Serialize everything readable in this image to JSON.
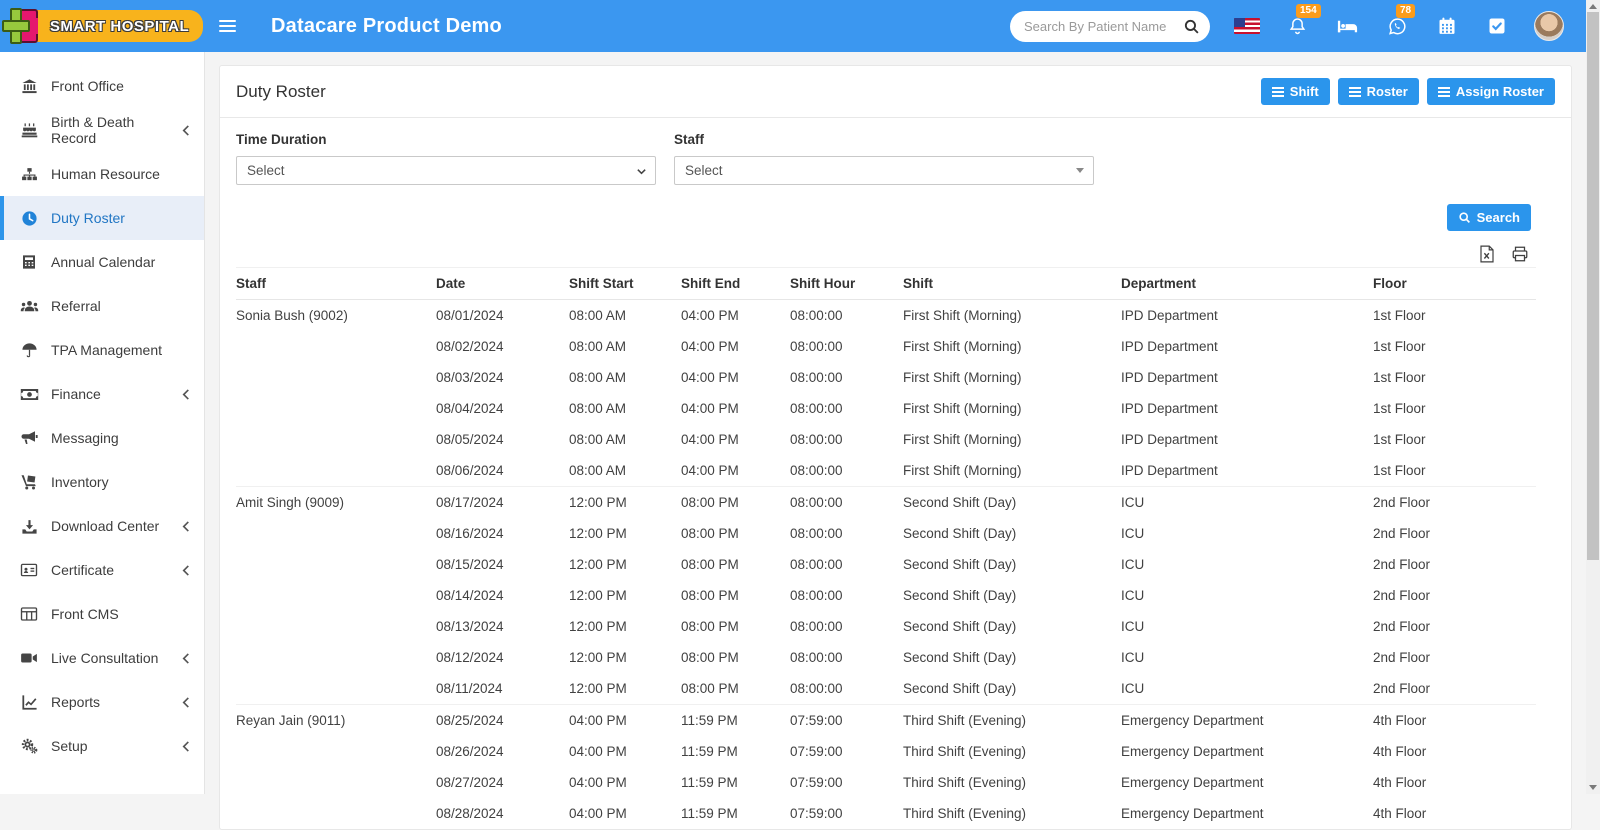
{
  "navbar": {
    "brand": "SMART HOSPITAL",
    "title": "Datacare Product Demo",
    "search_placeholder": "Search By Patient Name",
    "notification_badge": "154",
    "whatsapp_badge": "78"
  },
  "sidebar": {
    "items": [
      {
        "label": "Front Office"
      },
      {
        "label": "Birth & Death Record",
        "expandable": true
      },
      {
        "label": "Human Resource"
      },
      {
        "label": "Duty Roster",
        "active": true
      },
      {
        "label": "Annual Calendar"
      },
      {
        "label": "Referral"
      },
      {
        "label": "TPA Management"
      },
      {
        "label": "Finance",
        "expandable": true
      },
      {
        "label": "Messaging"
      },
      {
        "label": "Inventory"
      },
      {
        "label": "Download Center",
        "expandable": true
      },
      {
        "label": "Certificate",
        "expandable": true
      },
      {
        "label": "Front CMS"
      },
      {
        "label": "Live Consultation",
        "expandable": true
      },
      {
        "label": "Reports",
        "expandable": true
      },
      {
        "label": "Setup",
        "expandable": true
      }
    ]
  },
  "page": {
    "title": "Duty Roster",
    "buttons": {
      "shift": "Shift",
      "roster": "Roster",
      "assign_roster": "Assign Roster"
    },
    "filters": {
      "time_duration_label": "Time Duration",
      "time_duration_value": "Select",
      "staff_label": "Staff",
      "staff_value": "Select"
    },
    "search_button": "Search"
  },
  "table": {
    "headers": [
      "Staff",
      "Date",
      "Shift Start",
      "Shift End",
      "Shift Hour",
      "Shift",
      "Department",
      "Floor"
    ],
    "rows": [
      {
        "staff": "Sonia Bush (9002)",
        "date": "08/01/2024",
        "shift_start": "08:00 AM",
        "shift_end": "04:00 PM",
        "shift_hour": "08:00:00",
        "shift": "First Shift (Morning)",
        "department": "IPD Department",
        "floor": "1st Floor",
        "group_start": true
      },
      {
        "staff": "",
        "date": "08/02/2024",
        "shift_start": "08:00 AM",
        "shift_end": "04:00 PM",
        "shift_hour": "08:00:00",
        "shift": "First Shift (Morning)",
        "department": "IPD Department",
        "floor": "1st Floor"
      },
      {
        "staff": "",
        "date": "08/03/2024",
        "shift_start": "08:00 AM",
        "shift_end": "04:00 PM",
        "shift_hour": "08:00:00",
        "shift": "First Shift (Morning)",
        "department": "IPD Department",
        "floor": "1st Floor"
      },
      {
        "staff": "",
        "date": "08/04/2024",
        "shift_start": "08:00 AM",
        "shift_end": "04:00 PM",
        "shift_hour": "08:00:00",
        "shift": "First Shift (Morning)",
        "department": "IPD Department",
        "floor": "1st Floor"
      },
      {
        "staff": "",
        "date": "08/05/2024",
        "shift_start": "08:00 AM",
        "shift_end": "04:00 PM",
        "shift_hour": "08:00:00",
        "shift": "First Shift (Morning)",
        "department": "IPD Department",
        "floor": "1st Floor"
      },
      {
        "staff": "",
        "date": "08/06/2024",
        "shift_start": "08:00 AM",
        "shift_end": "04:00 PM",
        "shift_hour": "08:00:00",
        "shift": "First Shift (Morning)",
        "department": "IPD Department",
        "floor": "1st Floor"
      },
      {
        "staff": "Amit Singh (9009)",
        "date": "08/17/2024",
        "shift_start": "12:00 PM",
        "shift_end": "08:00 PM",
        "shift_hour": "08:00:00",
        "shift": "Second Shift (Day)",
        "department": "ICU",
        "floor": "2nd Floor",
        "group_start": true
      },
      {
        "staff": "",
        "date": "08/16/2024",
        "shift_start": "12:00 PM",
        "shift_end": "08:00 PM",
        "shift_hour": "08:00:00",
        "shift": "Second Shift (Day)",
        "department": "ICU",
        "floor": "2nd Floor"
      },
      {
        "staff": "",
        "date": "08/15/2024",
        "shift_start": "12:00 PM",
        "shift_end": "08:00 PM",
        "shift_hour": "08:00:00",
        "shift": "Second Shift (Day)",
        "department": "ICU",
        "floor": "2nd Floor"
      },
      {
        "staff": "",
        "date": "08/14/2024",
        "shift_start": "12:00 PM",
        "shift_end": "08:00 PM",
        "shift_hour": "08:00:00",
        "shift": "Second Shift (Day)",
        "department": "ICU",
        "floor": "2nd Floor"
      },
      {
        "staff": "",
        "date": "08/13/2024",
        "shift_start": "12:00 PM",
        "shift_end": "08:00 PM",
        "shift_hour": "08:00:00",
        "shift": "Second Shift (Day)",
        "department": "ICU",
        "floor": "2nd Floor"
      },
      {
        "staff": "",
        "date": "08/12/2024",
        "shift_start": "12:00 PM",
        "shift_end": "08:00 PM",
        "shift_hour": "08:00:00",
        "shift": "Second Shift (Day)",
        "department": "ICU",
        "floor": "2nd Floor"
      },
      {
        "staff": "",
        "date": "08/11/2024",
        "shift_start": "12:00 PM",
        "shift_end": "08:00 PM",
        "shift_hour": "08:00:00",
        "shift": "Second Shift (Day)",
        "department": "ICU",
        "floor": "2nd Floor"
      },
      {
        "staff": "Reyan Jain (9011)",
        "date": "08/25/2024",
        "shift_start": "04:00 PM",
        "shift_end": "11:59 PM",
        "shift_hour": "07:59:00",
        "shift": "Third Shift (Evening)",
        "department": "Emergency Department",
        "floor": "4th Floor",
        "group_start": true
      },
      {
        "staff": "",
        "date": "08/26/2024",
        "shift_start": "04:00 PM",
        "shift_end": "11:59 PM",
        "shift_hour": "07:59:00",
        "shift": "Third Shift (Evening)",
        "department": "Emergency Department",
        "floor": "4th Floor"
      },
      {
        "staff": "",
        "date": "08/27/2024",
        "shift_start": "04:00 PM",
        "shift_end": "11:59 PM",
        "shift_hour": "07:59:00",
        "shift": "Third Shift (Evening)",
        "department": "Emergency Department",
        "floor": "4th Floor"
      },
      {
        "staff": "",
        "date": "08/28/2024",
        "shift_start": "04:00 PM",
        "shift_end": "11:59 PM",
        "shift_hour": "07:59:00",
        "shift": "Third Shift (Evening)",
        "department": "Emergency Department",
        "floor": "4th Floor"
      }
    ]
  },
  "colors": {
    "navbar_blue": "#3b97f0",
    "button_blue": "#2b95ec",
    "badge_orange": "#fb9c1b",
    "active_sidebar_text": "#2176c4",
    "active_sidebar_bg": "#e8eef8",
    "logo_yellow": "#f8b31c",
    "logo_green": "#97c83d",
    "logo_magenta": "#e5176e"
  }
}
